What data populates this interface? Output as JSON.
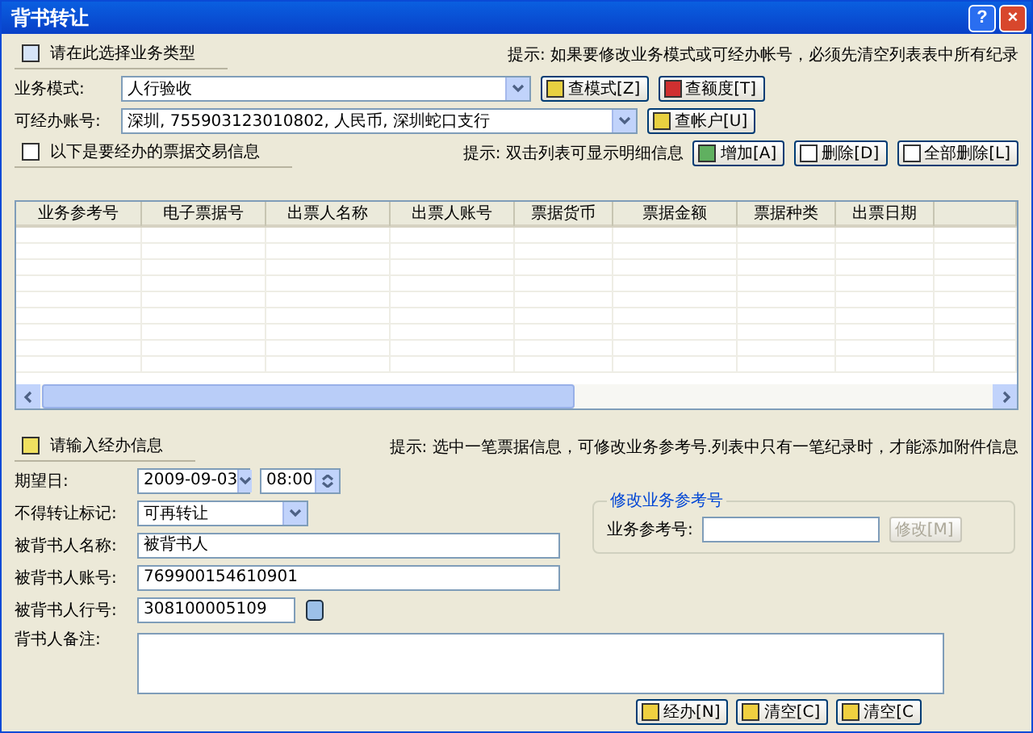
{
  "window": {
    "title": "背书转让",
    "help": "?",
    "close": "×"
  },
  "business_type": {
    "heading": "请在此选择业务类型",
    "hint": "提示: 如果要修改业务模式或可经办帐号，必须先清空列表表中所有纪录",
    "fields": [
      {
        "label": "业务模式:",
        "value": "人行验收",
        "buttons": [
          "查模式[Z]",
          "查额度[T]"
        ]
      },
      {
        "label": "可经办账号:",
        "value": "深圳, 755903123010802, 人民币, 深圳蛇口支行",
        "buttons": [
          "查帐户[U]"
        ]
      }
    ]
  },
  "transactions": {
    "heading": "以下是要经办的票据交易信息",
    "hint": "提示: 双击列表可显示明细信息",
    "buttons": [
      "增加[A]",
      "删除[D]",
      "全部删除[L]"
    ],
    "columns": [
      "业务参考号",
      "电子票据号",
      "出票人名称",
      "出票人账号",
      "票据货币",
      "票据金额",
      "票据种类",
      "出票日期"
    ]
  },
  "handling": {
    "heading": "请输入经办信息",
    "hint": "提示: 选中一笔票据信息，可修改业务参考号.列表中只有一笔纪录时，才能添加附件信息",
    "date_label": "期望日:",
    "date": "2009-09-03",
    "time": "08:00",
    "transfer_label": "不得转让标记:",
    "transfer": "可再转让",
    "name_label": "被背书人名称:",
    "name": "被背书人",
    "account_label": "被背书人账号:",
    "account": "769900154610901",
    "bank_label": "被背书人行号:",
    "bank": "308100005109",
    "remark_label": "背书人备注:"
  },
  "modify": {
    "title": "修改业务参考号",
    "label": "业务参考号:",
    "button": "修改[M]",
    "disabled": true
  },
  "actions": [
    "经办[N]",
    "清空[C]",
    "清空[C"
  ]
}
